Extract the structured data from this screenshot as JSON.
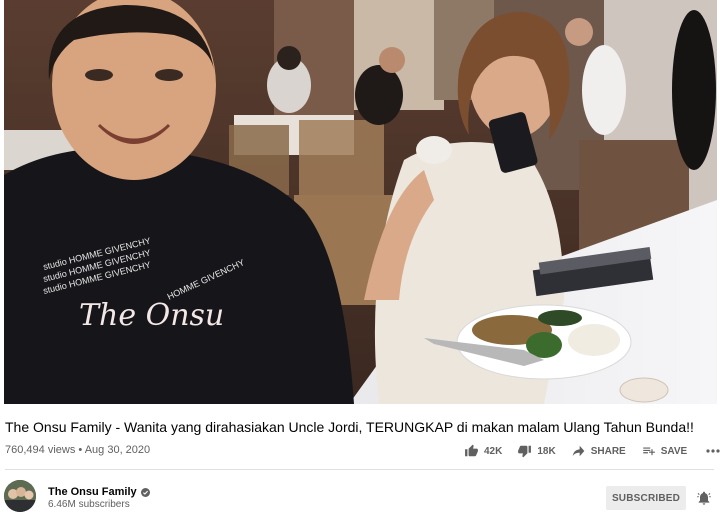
{
  "video": {
    "title": "The Onsu Family - Wanita yang dirahasiakan Uncle Jordi, TERUNGKAP di makan malam Ulang Tahun Bunda!!",
    "views": "760,494 views",
    "separator": "•",
    "date": "Aug 30, 2020"
  },
  "shirt_text": {
    "logo": "The Onsu",
    "line1": "studio HOMME GIVENCHY",
    "line2": "HOMME GIVENCHY"
  },
  "actions": {
    "likes": "42K",
    "dislikes": "18K",
    "share": "SHARE",
    "save": "SAVE"
  },
  "channel": {
    "name": "The Onsu Family",
    "subscribers": "6.46M subscribers",
    "subscribe_label": "SUBSCRIBED"
  },
  "colors": {
    "subscribed_bg": "#ececec",
    "meta_text": "#606060",
    "title_text": "#030303"
  }
}
